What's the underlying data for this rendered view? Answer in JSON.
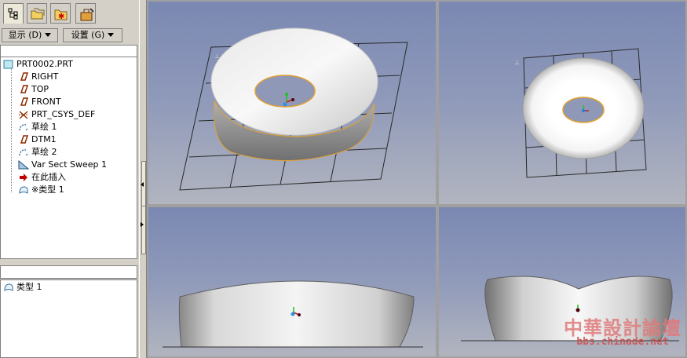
{
  "menubar": {
    "display_label": "显示 (D)",
    "settings_label": "设置 (G)"
  },
  "tabs": [
    {
      "name": "model-tree-tab",
      "active": true
    },
    {
      "name": "folder-browser-tab",
      "active": false
    },
    {
      "name": "favorites-tab",
      "active": false
    },
    {
      "name": "connections-tab",
      "active": false
    }
  ],
  "tree": {
    "root_label": "PRT0002.PRT",
    "items": [
      {
        "label": "RIGHT",
        "icon": "datum-plane-icon"
      },
      {
        "label": "TOP",
        "icon": "datum-plane-icon"
      },
      {
        "label": "FRONT",
        "icon": "datum-plane-icon"
      },
      {
        "label": "PRT_CSYS_DEF",
        "icon": "coordinate-system-icon"
      },
      {
        "label": "草绘 1",
        "icon": "sketch-icon"
      },
      {
        "label": "DTM1",
        "icon": "datum-plane-icon"
      },
      {
        "label": "草绘 2",
        "icon": "sketch-icon"
      },
      {
        "label": "Var Sect Sweep 1",
        "icon": "sweep-icon"
      },
      {
        "label": "在此插入",
        "icon": "insert-here-arrow-icon"
      },
      {
        "label": "※类型 1",
        "icon": "quilt-icon"
      }
    ]
  },
  "lower_panel": {
    "items": [
      {
        "label": "类型 1",
        "icon": "quilt-icon"
      }
    ]
  },
  "viewports": [
    {
      "name": "viewport-isometric"
    },
    {
      "name": "viewport-top"
    },
    {
      "name": "viewport-front"
    },
    {
      "name": "viewport-side"
    }
  ],
  "watermark": {
    "title": "中華設計論壇",
    "url": "bbs.chinade.net"
  },
  "colors": {
    "viewport_top": "#7a88b2",
    "viewport_bottom": "#b2b5bf",
    "edge_highlight": "#e0a030",
    "grid": "#303030"
  }
}
